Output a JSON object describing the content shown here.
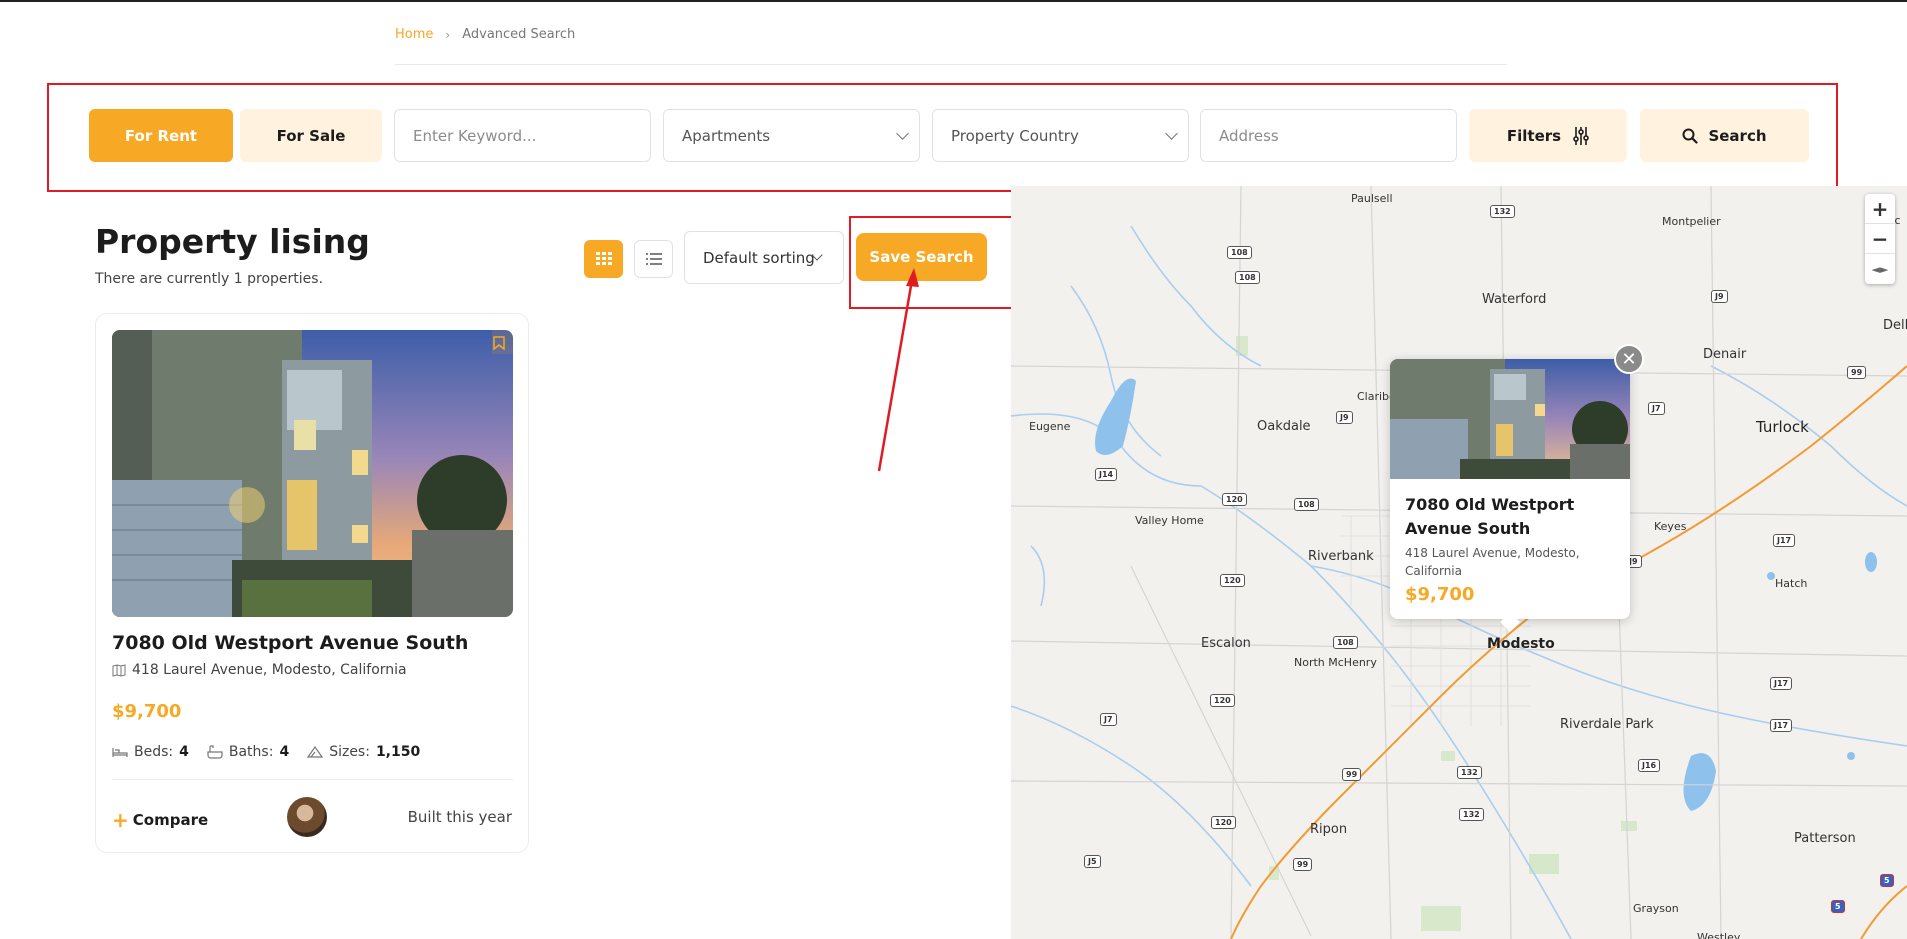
{
  "breadcrumb": {
    "home": "Home",
    "separator": "›",
    "current": "Advanced Search"
  },
  "search_bar": {
    "for_rent": "For Rent",
    "for_sale": "For Sale",
    "keyword_placeholder": "Enter Keyword...",
    "type_value": "Apartments",
    "country_value": "Property Country",
    "address_placeholder": "Address",
    "filters_label": "Filters",
    "search_label": "Search"
  },
  "listing": {
    "title": "Property lising",
    "subtitle": "There are currently 1 properties.",
    "sorting": "Default sorting",
    "save_search": "Save Search"
  },
  "card": {
    "title": "7080 Old Westport Avenue South",
    "address": "418 Laurel Avenue, Modesto, California",
    "price": "$9,700",
    "beds_label": "Beds:",
    "beds": "4",
    "baths_label": "Baths:",
    "baths": "4",
    "sizes_label": "Sizes:",
    "sizes": "1,150",
    "compare": "Compare",
    "built": "Built this year"
  },
  "map": {
    "popup": {
      "title": "7080 Old Westport Avenue South",
      "address": "418 Laurel Avenue, Modesto, California",
      "price": "$9,700"
    },
    "places": {
      "paulsell": "Paulsell",
      "montpelier": "Montpelier",
      "ballico": "Ballic",
      "waterford": "Waterford",
      "denair": "Denair",
      "delhi": "Dell",
      "turlock": "Turlock",
      "eugene": "Eugene",
      "claribel": "Claribe",
      "oakdale": "Oakdale",
      "valley_home": "Valley Home",
      "riverbank": "Riverbank",
      "keyes": "Keyes",
      "hatch": "Hatch",
      "escalon": "Escalon",
      "north_mchenry": "North McHenry",
      "modesto": "Modesto",
      "riverdale_park": "Riverdale Park",
      "ripon": "Ripon",
      "patterson": "Patterson",
      "grayson": "Grayson",
      "westley": "Westley"
    },
    "shields": {
      "s132a": "132",
      "s108a": "108",
      "s108b": "108",
      "j9a": "J9",
      "j9b": "J9",
      "s99a": "99",
      "j7a": "J7",
      "j14": "J14",
      "s120a": "120",
      "s108c": "108",
      "j17a": "J17",
      "s120b": "120",
      "s108d": "108",
      "s120c": "120",
      "j17b": "J17",
      "j17c": "J17",
      "j7b": "J7",
      "s99b": "99",
      "s132b": "132",
      "j16": "J16",
      "s132c": "132",
      "s120d": "120",
      "j5": "J5",
      "s99c": "99",
      "i5": "5",
      "j9c": "J9"
    },
    "zoom_in": "+",
    "zoom_out": "−",
    "compass": "◄►"
  },
  "colors": {
    "accent": "#f7a825",
    "accent_light": "#fff2df",
    "annotation": "#e01b24"
  }
}
